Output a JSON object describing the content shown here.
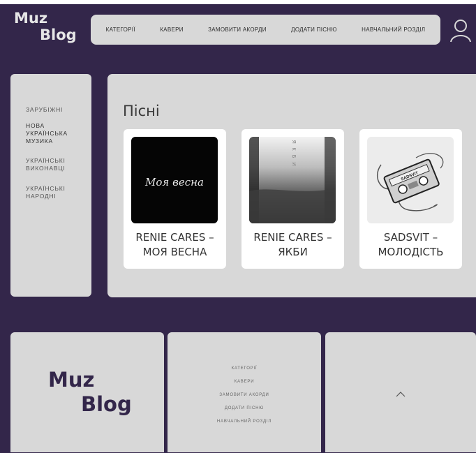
{
  "logo": {
    "line1": "Muz",
    "line2": "Blog"
  },
  "nav": {
    "items": [
      "Категорії",
      "Кавери",
      "Замовити акорди",
      "Додати пісню",
      "Навчальний розділ"
    ]
  },
  "sidebar": {
    "items": [
      "Зарубіжні",
      "Нова українська музика",
      "Українські виконавці",
      "Українські народні"
    ]
  },
  "content": {
    "title": "Пісні",
    "cards": [
      {
        "caption": "Renie Cares – Моя весна",
        "art_text": "Моя весна",
        "art_icon": "handwritten-title-art"
      },
      {
        "caption": "Renie Cares – Якби",
        "art_text": "ЯКБИ",
        "art_icon": "blurred-sea-photo"
      },
      {
        "caption": "Sadsvit – Молодість",
        "art_text": "SADSVIT",
        "art_icon": "cassette-drawing"
      }
    ]
  },
  "footer": {
    "logo": {
      "line1": "Muz",
      "line2": "Blog"
    },
    "links": [
      "Категорії",
      "Кавери",
      "Замовити акорди",
      "Додати пісню",
      "Навчальний розділ"
    ]
  },
  "icons": {
    "user": "user-icon",
    "scroll_up": "chevron-up-icon"
  },
  "colors": {
    "background": "#33264a",
    "panel": "#d8d8d8",
    "card": "#ffffff",
    "brand_text": "#33264a"
  }
}
